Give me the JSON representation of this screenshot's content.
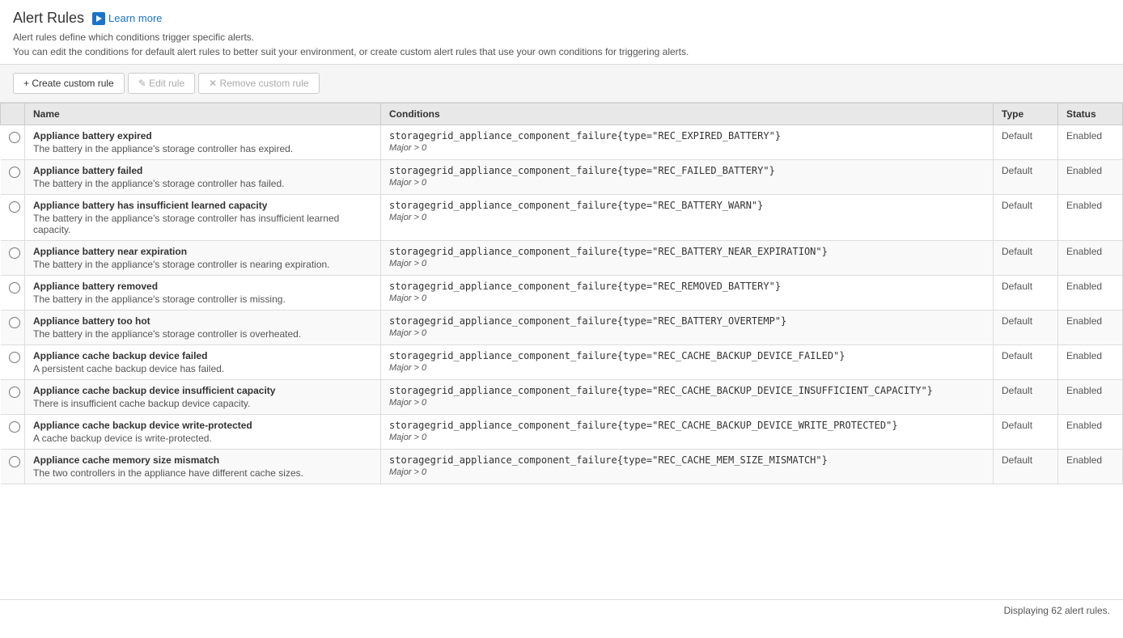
{
  "header": {
    "title": "Alert Rules",
    "learn_more_label": "Learn more",
    "description1": "Alert rules define which conditions trigger specific alerts.",
    "description2": "You can edit the conditions for default alert rules to better suit your environment, or create custom alert rules that use your own conditions for triggering alerts."
  },
  "toolbar": {
    "create_label": "+ Create custom rule",
    "edit_label": "✎ Edit rule",
    "remove_label": "✕ Remove custom rule"
  },
  "table": {
    "columns": {
      "name": "Name",
      "conditions": "Conditions",
      "type": "Type",
      "status": "Status"
    },
    "rows": [
      {
        "name": "Appliance battery expired",
        "description": "The battery in the appliance's storage controller has expired.",
        "condition_expr": "storagegrid_appliance_component_failure{type=\"REC_EXPIRED_BATTERY\"}",
        "condition_severity": "Major > 0",
        "type": "Default",
        "status": "Enabled"
      },
      {
        "name": "Appliance battery failed",
        "description": "The battery in the appliance's storage controller has failed.",
        "condition_expr": "storagegrid_appliance_component_failure{type=\"REC_FAILED_BATTERY\"}",
        "condition_severity": "Major > 0",
        "type": "Default",
        "status": "Enabled"
      },
      {
        "name": "Appliance battery has insufficient learned capacity",
        "description": "The battery in the appliance's storage controller has insufficient learned capacity.",
        "condition_expr": "storagegrid_appliance_component_failure{type=\"REC_BATTERY_WARN\"}",
        "condition_severity": "Major > 0",
        "type": "Default",
        "status": "Enabled"
      },
      {
        "name": "Appliance battery near expiration",
        "description": "The battery in the appliance's storage controller is nearing expiration.",
        "condition_expr": "storagegrid_appliance_component_failure{type=\"REC_BATTERY_NEAR_EXPIRATION\"}",
        "condition_severity": "Major > 0",
        "type": "Default",
        "status": "Enabled"
      },
      {
        "name": "Appliance battery removed",
        "description": "The battery in the appliance's storage controller is missing.",
        "condition_expr": "storagegrid_appliance_component_failure{type=\"REC_REMOVED_BATTERY\"}",
        "condition_severity": "Major > 0",
        "type": "Default",
        "status": "Enabled"
      },
      {
        "name": "Appliance battery too hot",
        "description": "The battery in the appliance's storage controller is overheated.",
        "condition_expr": "storagegrid_appliance_component_failure{type=\"REC_BATTERY_OVERTEMP\"}",
        "condition_severity": "Major > 0",
        "type": "Default",
        "status": "Enabled"
      },
      {
        "name": "Appliance cache backup device failed",
        "description": "A persistent cache backup device has failed.",
        "condition_expr": "storagegrid_appliance_component_failure{type=\"REC_CACHE_BACKUP_DEVICE_FAILED\"}",
        "condition_severity": "Major > 0",
        "type": "Default",
        "status": "Enabled"
      },
      {
        "name": "Appliance cache backup device insufficient capacity",
        "description": "There is insufficient cache backup device capacity.",
        "condition_expr": "storagegrid_appliance_component_failure{type=\"REC_CACHE_BACKUP_DEVICE_INSUFFICIENT_CAPACITY\"}",
        "condition_severity": "Major > 0",
        "type": "Default",
        "status": "Enabled"
      },
      {
        "name": "Appliance cache backup device write-protected",
        "description": "A cache backup device is write-protected.",
        "condition_expr": "storagegrid_appliance_component_failure{type=\"REC_CACHE_BACKUP_DEVICE_WRITE_PROTECTED\"}",
        "condition_severity": "Major > 0",
        "type": "Default",
        "status": "Enabled"
      },
      {
        "name": "Appliance cache memory size mismatch",
        "description": "The two controllers in the appliance have different cache sizes.",
        "condition_expr": "storagegrid_appliance_component_failure{type=\"REC_CACHE_MEM_SIZE_MISMATCH\"}",
        "condition_severity": "Major > 0",
        "type": "Default",
        "status": "Enabled"
      }
    ]
  },
  "footer": {
    "display_text": "Displaying 62 alert rules."
  }
}
